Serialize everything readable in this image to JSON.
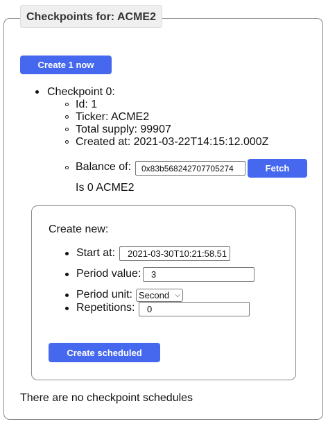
{
  "legend": {
    "prefix": "Checkpoints for: ",
    "ticker": "ACME2"
  },
  "create_now_button": "Create 1 now",
  "checkpoint": {
    "title": "Checkpoint 0:",
    "id_line": "Id: 1",
    "ticker_line": "Ticker: ACME2",
    "supply_line": "Total supply: 99907",
    "created_line": "Created at: 2021-03-22T14:15:12.000Z",
    "balance_label": "Balance of:",
    "balance_input": "0x83b568242707705274",
    "fetch_button": "Fetch",
    "balance_result": "Is 0 ACME2"
  },
  "create_new": {
    "heading": "Create new:",
    "start_label": "Start at:",
    "start_value": "2021-03-30T10:21:58.51",
    "period_value_label": "Period value:",
    "period_value": "3",
    "period_unit_label": "Period unit:",
    "period_unit": "Second",
    "repetitions_label": "Repetitions:",
    "repetitions_value": "0",
    "create_button": "Create scheduled"
  },
  "footer_text": "There are no checkpoint schedules"
}
